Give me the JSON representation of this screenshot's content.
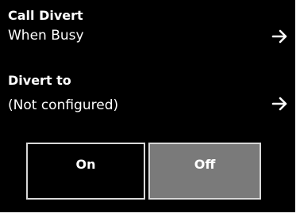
{
  "call_divert": {
    "title": "Call Divert",
    "value": "When Busy",
    "arrow_icon": "right-arrow-icon"
  },
  "divert_to": {
    "title": "Divert to",
    "value": "(Not configured)",
    "arrow_icon": "right-arrow-icon"
  },
  "toggle": {
    "on_label": "On",
    "off_label": "Off",
    "selected": "Off"
  },
  "colors": {
    "background": "#000000",
    "text": "#ffffff",
    "selected_toggle": "#7a7a7a",
    "toggle_border": "#d8d8d8"
  }
}
